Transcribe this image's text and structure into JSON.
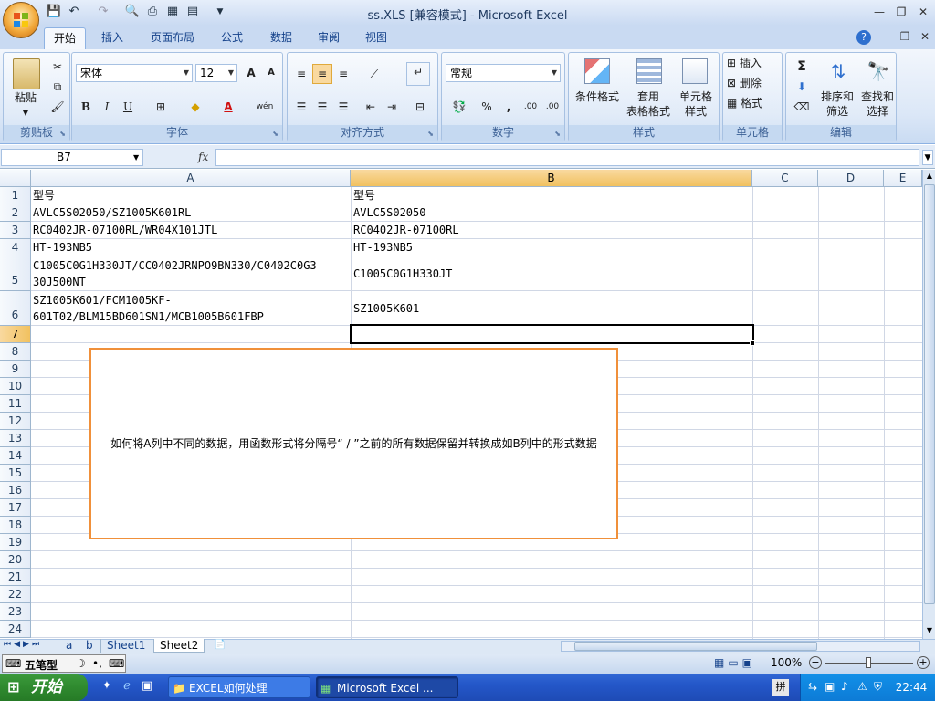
{
  "window": {
    "title": "ss.XLS  [兼容模式] - Microsoft Excel"
  },
  "ribbon_tabs": [
    "开始",
    "插入",
    "页面布局",
    "公式",
    "数据",
    "审阅",
    "视图"
  ],
  "ribbon": {
    "clipboard": {
      "paste": "粘贴",
      "label": "剪贴板"
    },
    "font": {
      "name": "宋体",
      "size": "12",
      "label": "字体",
      "grow": "A",
      "shrink": "A",
      "bold": "B",
      "italic": "I",
      "underline": "U",
      "color": "A",
      "phonetic": "wén"
    },
    "alignment": {
      "label": "对齐方式"
    },
    "number": {
      "format": "常规",
      "label": "数字",
      "percent": "%",
      "comma": ",",
      "inc": ".00",
      "dec": ".00"
    },
    "styles": {
      "cond": "条件格式",
      "table1": "套用",
      "table2": "表格格式",
      "cell1": "单元格",
      "cell2": "样式",
      "label": "样式"
    },
    "cells": {
      "insert": "插入",
      "delete": "删除",
      "format": "格式",
      "label": "单元格"
    },
    "editing": {
      "sum": "Σ",
      "sort1": "排序和",
      "sort2": "筛选",
      "find1": "查找和",
      "find2": "选择",
      "label": "编辑"
    }
  },
  "formula_bar": {
    "name_box": "B7",
    "fx": "fx",
    "formula": ""
  },
  "columns": [
    "A",
    "B",
    "C",
    "D",
    "E"
  ],
  "rows": [
    "1",
    "2",
    "3",
    "4",
    "5",
    "6",
    "7",
    "8",
    "9",
    "10",
    "11",
    "12",
    "13",
    "14",
    "15",
    "16",
    "17",
    "18",
    "19",
    "20",
    "21",
    "22",
    "23",
    "24"
  ],
  "cells": {
    "A1": "型号",
    "B1": "型号",
    "A2": "AVLC5S02050/SZ1005K601RL",
    "B2": "AVLC5S02050",
    "A3": "RC0402JR-07100RL/WR04X101JTL",
    "B3": "RC0402JR-07100RL",
    "A4": "HT-193NB5",
    "B4": "HT-193NB5",
    "A5a": "C1005C0G1H330JT/CC0402JRNPO9BN330/C0402C0G3",
    "A5b": "30J500NT",
    "B5": "C1005C0G1H330JT",
    "A6a": "SZ1005K601/FCM1005KF-",
    "A6b": "601T02/BLM15BD601SN1/MCB1005B601FBP",
    "B6": "SZ1005K601"
  },
  "textbox": "如何将A列中不同的数据，用函数形式将分隔号“ / ”之前的所有数据保留并转换成如B列中的形式数据",
  "sheet_tabs": [
    "a",
    "b",
    "Sheet1",
    "Sheet2"
  ],
  "active_sheet": "Sheet2",
  "status": {
    "ime": "五笔型",
    "zoom": "100%"
  },
  "taskbar": {
    "start": "开始",
    "tasks": [
      "EXCEL如何处理",
      "Microsoft Excel ..."
    ],
    "clock": "22:44"
  },
  "colors": {
    "accent": "#f1c15f",
    "ribbon": "#dbe7f7",
    "taskbar": "#2457c9",
    "textbox_border": "#f0903a"
  }
}
